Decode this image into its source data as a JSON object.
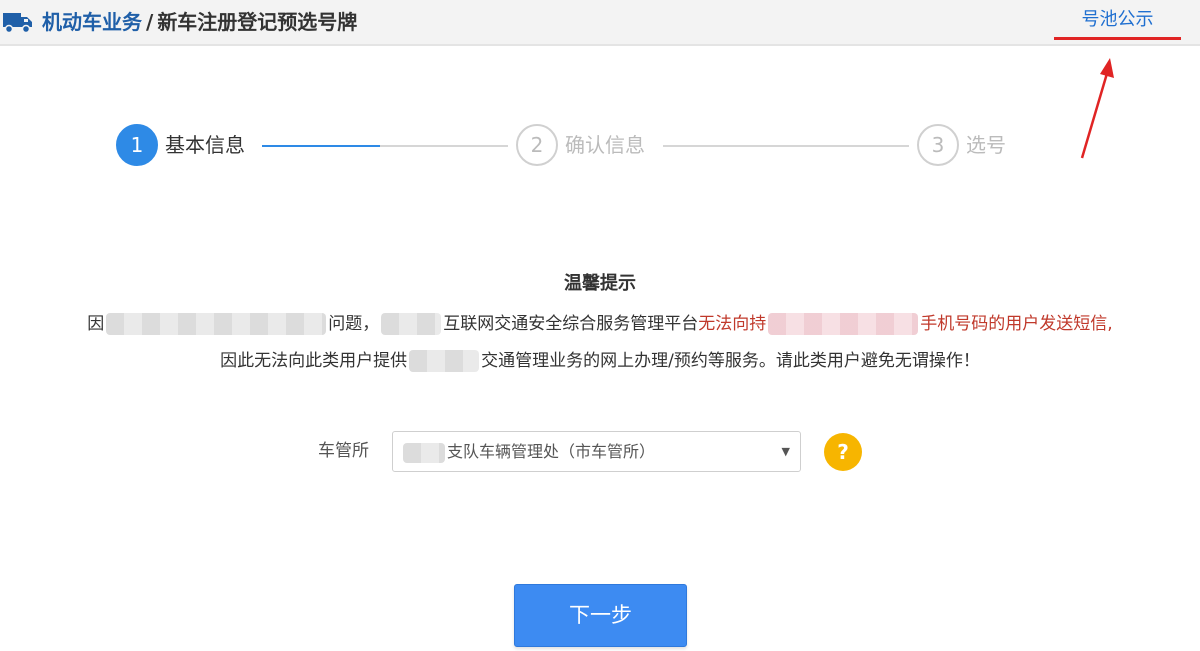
{
  "header": {
    "breadcrumb_section": "机动车业务",
    "breadcrumb_separator": "/",
    "breadcrumb_page": "新车注册登记预选号牌",
    "pool_link": "号池公示"
  },
  "steps": [
    {
      "number": "1",
      "label": "基本信息",
      "state": "active"
    },
    {
      "number": "2",
      "label": "确认信息",
      "state": "inactive"
    },
    {
      "number": "3",
      "label": "选号",
      "state": "inactive"
    }
  ],
  "notice": {
    "title": "温馨提示",
    "line1_part1": "因",
    "line1_part2": "问题，",
    "line1_part3": "互联网交通安全综合服务管理平台",
    "line1_red1": "无法向持",
    "line1_red2": "手机号码的用户发送短信,",
    "line2_part1": "因此无法向此类用户提供",
    "line2_part2": "交通管理业务的网上办理/预约等服务。请此类用户避免无谓操作！"
  },
  "form": {
    "office_label": "车管所",
    "office_value": "支队车辆管理处（市车管所）",
    "help_symbol": "?"
  },
  "actions": {
    "next_label": "下一步"
  },
  "colors": {
    "brand_blue": "#1f5fa8",
    "step_active": "#2e8ae6",
    "notice_red": "#c0392b",
    "button_blue": "#3d8bf2",
    "help_yellow": "#f7b500"
  },
  "icons": {
    "header_icon": "truck-icon",
    "help_icon": "question-icon",
    "select_arrow": "caret-down-icon"
  }
}
